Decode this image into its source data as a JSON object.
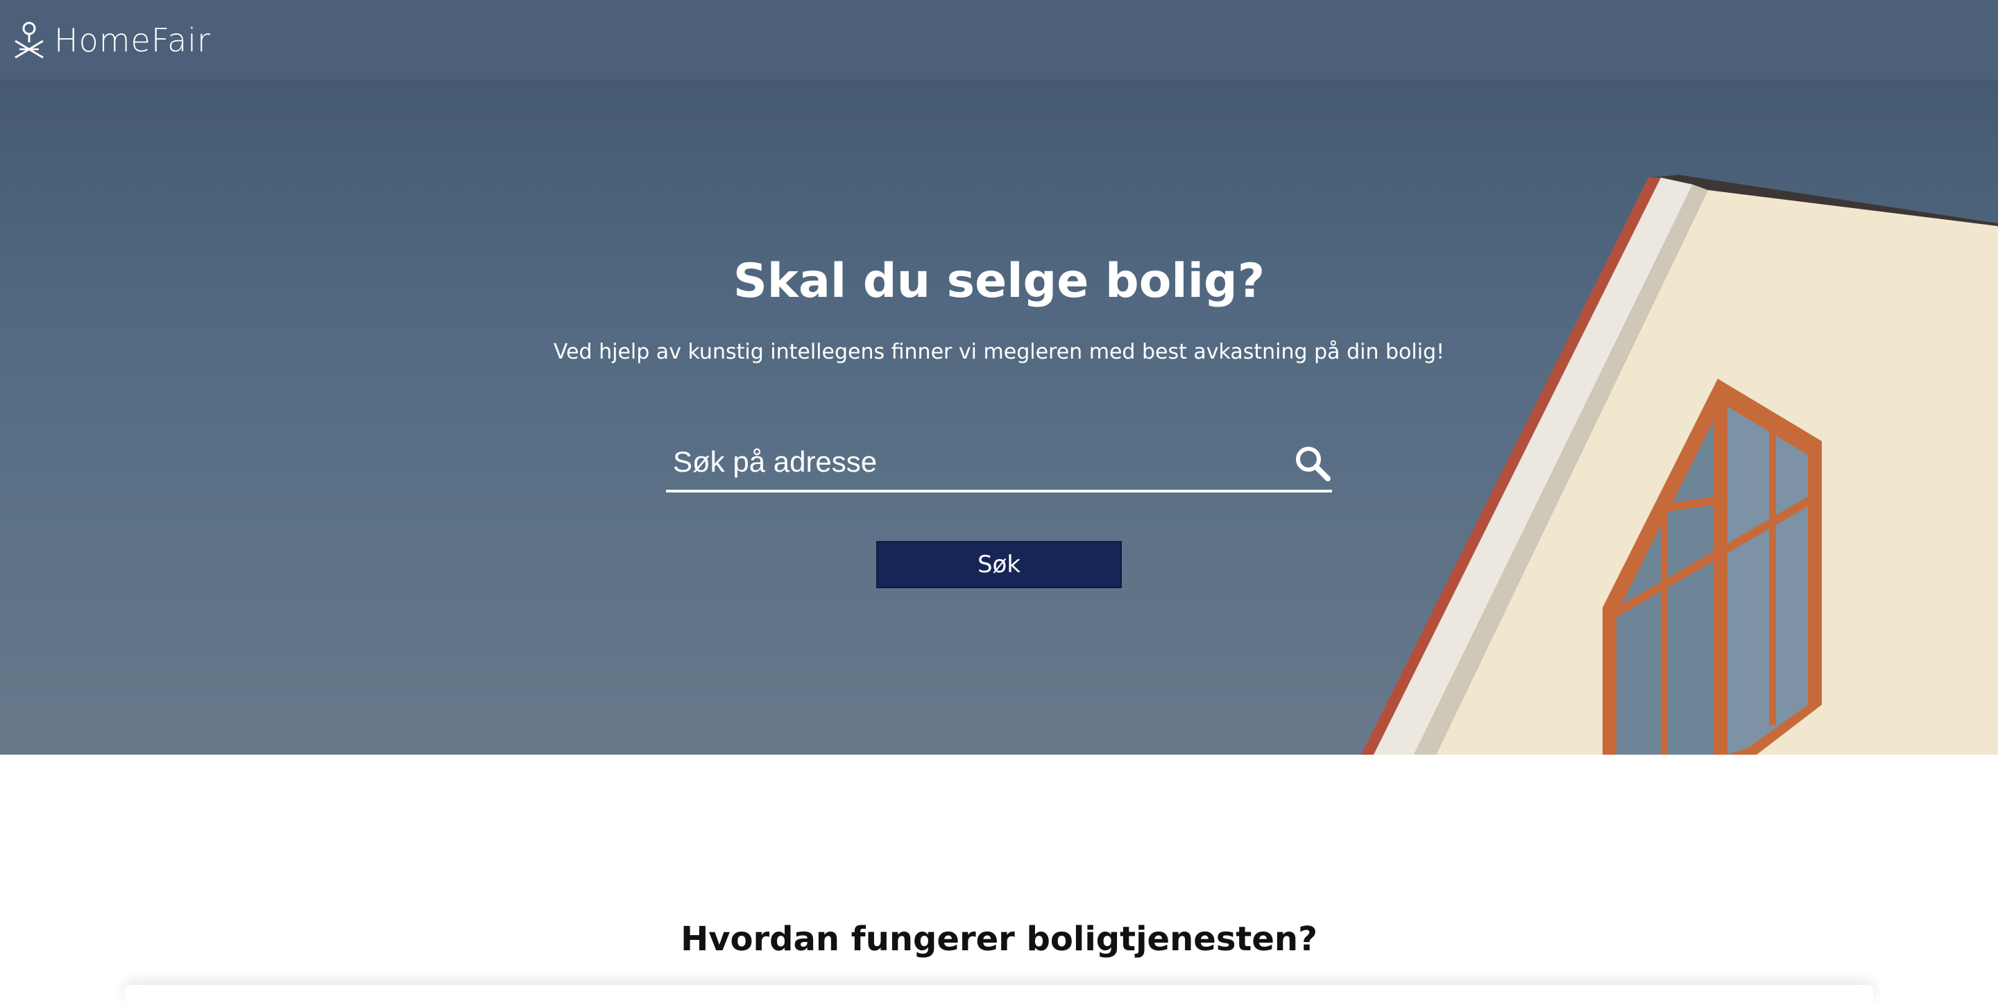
{
  "header": {
    "brand": "HomeFair",
    "logo_icon": "location-pin-leaf-icon"
  },
  "hero": {
    "title": "Skal du selge bolig?",
    "subtitle": "Ved hjelp av kunstig intellegens finner vi megleren med best avkastning på din bolig!",
    "search": {
      "placeholder": "Søk på adresse",
      "value": "",
      "icon": "search-icon"
    },
    "button_label": "Søk"
  },
  "how_it_works": {
    "title": "Hvordan fungerer boligtjenesten?"
  },
  "colors": {
    "header_bg": "#4d6079",
    "sky": "#526981",
    "button_bg": "#172456",
    "text_on_dark": "#ffffff"
  }
}
